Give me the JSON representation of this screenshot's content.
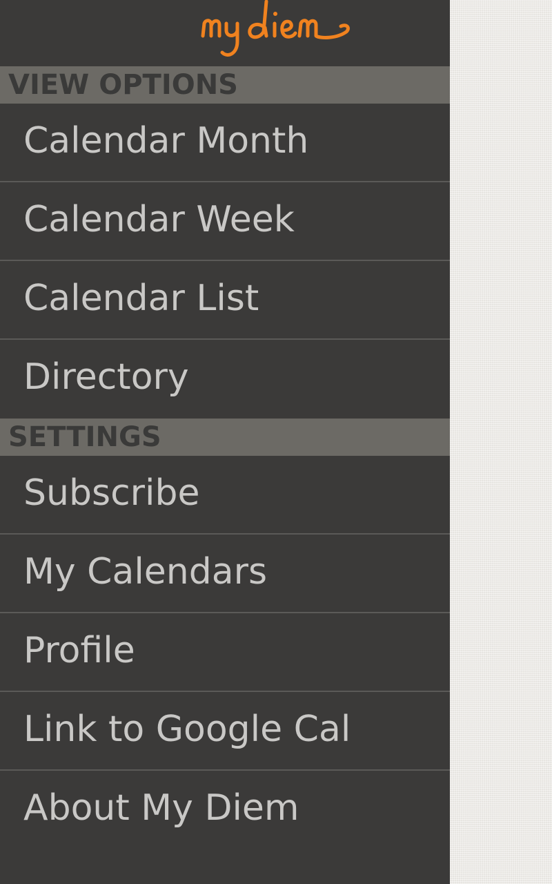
{
  "brand": {
    "logo_text": "my diem",
    "logo_color": "#f0821f"
  },
  "sections": [
    {
      "header": "VIEW OPTIONS",
      "items": [
        {
          "label": "Calendar Month"
        },
        {
          "label": "Calendar Week"
        },
        {
          "label": "Calendar List"
        },
        {
          "label": "Directory"
        }
      ]
    },
    {
      "header": "SETTINGS",
      "items": [
        {
          "label": "Subscribe"
        },
        {
          "label": "My Calendars"
        },
        {
          "label": "Profile"
        },
        {
          "label": "Link to Google Cal"
        },
        {
          "label": "About My Diem"
        }
      ]
    }
  ],
  "colors": {
    "drawer_bg": "#3b3a39",
    "section_header_bg": "#6c6a65",
    "item_text": "#c9c8c6",
    "background_texture": "#ebe9e4"
  }
}
